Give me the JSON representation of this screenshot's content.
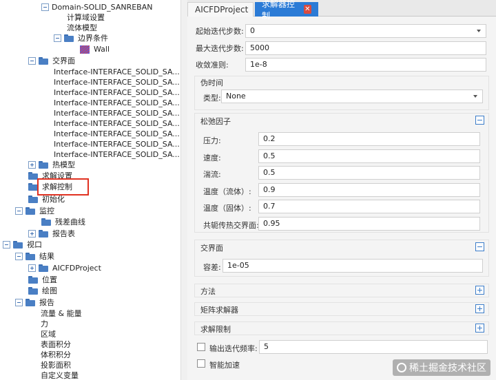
{
  "tree": {
    "domain": "Domain-SOLID_SANREBAN",
    "compute_domain_settings": "计算域设置",
    "fluid_model": "流体模型",
    "boundary_conditions": "边界条件",
    "wall": "Wall",
    "interfaces": "交界面",
    "interface_items": [
      "Interface-INTERFACE_SOLID_SA...",
      "Interface-INTERFACE_SOLID_SA...",
      "Interface-INTERFACE_SOLID_SA...",
      "Interface-INTERFACE_SOLID_SA...",
      "Interface-INTERFACE_SOLID_SA...",
      "Interface-INTERFACE_SOLID_SA...",
      "Interface-INTERFACE_SOLID_SA...",
      "Interface-INTERFACE_SOLID_SA...",
      "Interface-INTERFACE_SOLID_SA..."
    ],
    "heat_model": "热模型",
    "solver_settings": "求解设置",
    "solver_control": "求解控制",
    "initialization": "初始化",
    "monitor": "监控",
    "residual_curve": "残差曲线",
    "report_table": "报告表",
    "viewport": "视口",
    "results": "结果",
    "project": "AICFDProject",
    "position": "位置",
    "plot": "绘图",
    "report": "报告",
    "report_items": [
      "流量 & 能量",
      "力",
      "区域",
      "表面积分",
      "体积积分",
      "投影面积",
      "自定义变量"
    ]
  },
  "tabs": {
    "tab1": "AICFDProject",
    "tab2": "求解器控制",
    "close_glyph": "✕"
  },
  "form": {
    "start_iter_label": "起始迭代步数:",
    "start_iter_value": "0",
    "max_iter_label": "最大迭代步数:",
    "max_iter_value": "5000",
    "convergence_label": "收敛准则:",
    "convergence_value": "1e-8",
    "pseudo_time": {
      "title": "伪时间",
      "type_label": "类型:",
      "type_value": "None"
    },
    "relaxation": {
      "title": "松弛因子",
      "pressure_label": "压力:",
      "pressure_value": "0.2",
      "velocity_label": "速度:",
      "velocity_value": "0.5",
      "turbulence_label": "湍流:",
      "turbulence_value": "0.5",
      "temp_fluid_label": "温度（流体）:",
      "temp_fluid_value": "0.9",
      "temp_solid_label": "温度（固体）:",
      "temp_solid_value": "0.7",
      "conjugate_label": "共轭传热交界面:",
      "conjugate_value": "0.95"
    },
    "interface": {
      "title": "交界面",
      "tolerance_label": "容差:",
      "tolerance_value": "1e-05"
    },
    "method_title": "方法",
    "matrix_solver_title": "矩阵求解器",
    "solve_limits_title": "求解限制",
    "output_freq_label": "输出迭代频率:",
    "output_freq_value": "5",
    "smart_accel_label": "智能加速"
  },
  "watermark": "稀土掘金技术社区",
  "colors": {
    "tab_active": "#2b7bd6",
    "highlight_box": "#e03020",
    "folder": "#4a7fc4"
  }
}
